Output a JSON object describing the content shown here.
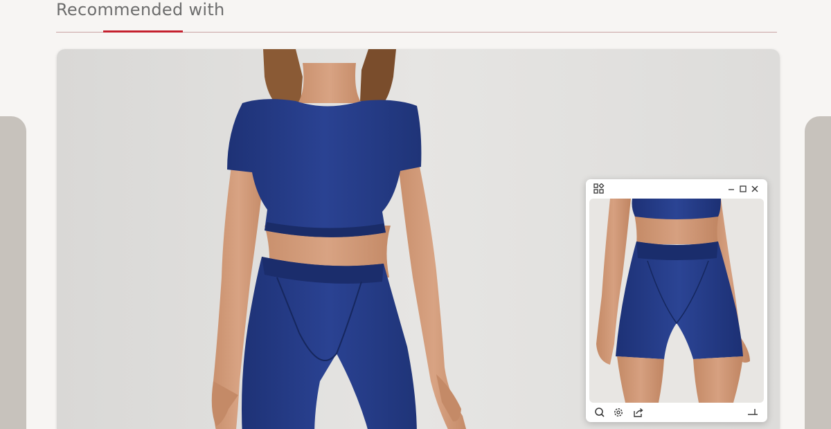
{
  "section": {
    "title": "Recommended with"
  },
  "colors": {
    "accent": "#c4202e",
    "garment": "#243a86",
    "side_panel": "#c7c2bc"
  },
  "main_image": {
    "subject": "model wearing navy short-sleeve crop top and high-waist leggings"
  },
  "preview_window": {
    "titlebar_icons": [
      "apps-icon",
      "minimize-icon",
      "maximize-icon",
      "close-icon"
    ],
    "image_subject": "model wearing navy bra top and high-waist shorts",
    "toolbar_icons": [
      "zoom-icon",
      "settings-icon",
      "share-icon",
      "pin-icon"
    ]
  }
}
